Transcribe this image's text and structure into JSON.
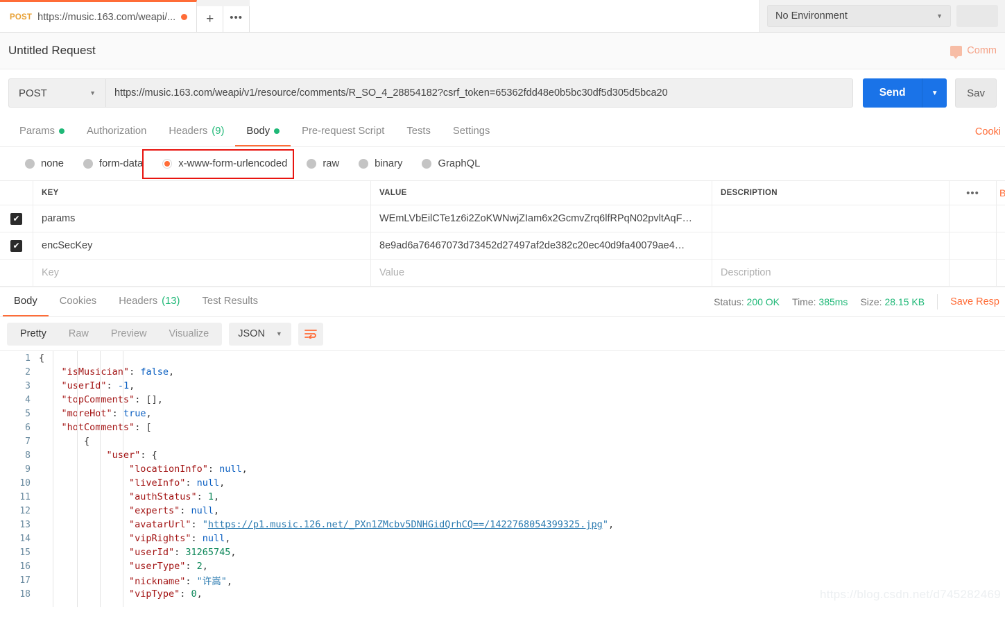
{
  "tab": {
    "method": "POST",
    "url_short": "https://music.163.com/weapi/...",
    "new_tab_icon": "plus-icon",
    "more_icon": "ellipsis-icon"
  },
  "environment": {
    "selected": "No Environment",
    "caret": "▼"
  },
  "header": {
    "title": "Untitled Request",
    "comments_label": "Comm"
  },
  "request": {
    "method": "POST",
    "url": "https://music.163.com/weapi/v1/resource/comments/R_SO_4_28854182?csrf_token=65362fdd48e0b5bc30df5d305d5bca20",
    "send_label": "Send",
    "send_caret": "▼",
    "save_label": "Sav",
    "method_caret": "▼"
  },
  "request_tabs": [
    {
      "label": "Params",
      "dot": true,
      "count": "",
      "active": false
    },
    {
      "label": "Authorization",
      "dot": false,
      "count": "",
      "active": false
    },
    {
      "label": "Headers",
      "dot": false,
      "count": "(9)",
      "active": false
    },
    {
      "label": "Body",
      "dot": true,
      "count": "",
      "active": true
    },
    {
      "label": "Pre-request Script",
      "dot": false,
      "count": "",
      "active": false
    },
    {
      "label": "Tests",
      "dot": false,
      "count": "",
      "active": false
    },
    {
      "label": "Settings",
      "dot": false,
      "count": "",
      "active": false
    }
  ],
  "cookies_link": "Cooki",
  "body_modes": [
    {
      "label": "none",
      "selected": false
    },
    {
      "label": "form-data",
      "selected": false
    },
    {
      "label": "x-www-form-urlencoded",
      "selected": true
    },
    {
      "label": "raw",
      "selected": false
    },
    {
      "label": "binary",
      "selected": false
    },
    {
      "label": "GraphQL",
      "selected": false
    }
  ],
  "highlight_color": "#e8140f",
  "kv_table": {
    "headers": {
      "key": "KEY",
      "value": "VALUE",
      "description": "DESCRIPTION",
      "actions": "•••",
      "bulk": "B"
    },
    "rows": [
      {
        "checked": true,
        "key": "params",
        "value": "WEmLVbEilCTe1z6i2ZoKWNwjZIam6x2GcmvZrq6lfRPqN02pvltAqF…",
        "description": ""
      },
      {
        "checked": true,
        "key": "encSecKey",
        "value": "8e9ad6a76467073d73452d27497af2de382c20ec40d9fa40079ae4…",
        "description": ""
      }
    ],
    "empty_row": {
      "key": "Key",
      "value": "Value",
      "description": "Description"
    }
  },
  "response_tabs": [
    {
      "label": "Body",
      "count": "",
      "active": true
    },
    {
      "label": "Cookies",
      "count": "",
      "active": false
    },
    {
      "label": "Headers",
      "count": "(13)",
      "active": false
    },
    {
      "label": "Test Results",
      "count": "",
      "active": false
    }
  ],
  "response_meta": {
    "status_label": "Status:",
    "status_value": "200 OK",
    "time_label": "Time:",
    "time_value": "385ms",
    "size_label": "Size:",
    "size_value": "28.15 KB",
    "save_response": "Save Resp"
  },
  "response_toolbar": {
    "view_modes": [
      {
        "label": "Pretty",
        "active": true
      },
      {
        "label": "Raw",
        "active": false
      },
      {
        "label": "Preview",
        "active": false
      },
      {
        "label": "Visualize",
        "active": false
      }
    ],
    "format": "JSON",
    "format_caret": "▼",
    "wrap_icon": "wrap-lines-icon"
  },
  "code": {
    "lines": [
      {
        "n": "1",
        "indent": 0,
        "tokens": [
          {
            "t": "p",
            "v": "{"
          }
        ]
      },
      {
        "n": "2",
        "indent": 1,
        "tokens": [
          {
            "t": "k",
            "v": "\"isMusician\""
          },
          {
            "t": "p",
            "v": ": "
          },
          {
            "t": "b",
            "v": "false"
          },
          {
            "t": "p",
            "v": ","
          }
        ]
      },
      {
        "n": "3",
        "indent": 1,
        "tokens": [
          {
            "t": "k",
            "v": "\"userId\""
          },
          {
            "t": "p",
            "v": ": "
          },
          {
            "t": "b",
            "v": "-1"
          },
          {
            "t": "p",
            "v": ","
          }
        ]
      },
      {
        "n": "4",
        "indent": 1,
        "tokens": [
          {
            "t": "k",
            "v": "\"topComments\""
          },
          {
            "t": "p",
            "v": ": [],"
          }
        ]
      },
      {
        "n": "5",
        "indent": 1,
        "tokens": [
          {
            "t": "k",
            "v": "\"moreHot\""
          },
          {
            "t": "p",
            "v": ": "
          },
          {
            "t": "b",
            "v": "true"
          },
          {
            "t": "p",
            "v": ","
          }
        ]
      },
      {
        "n": "6",
        "indent": 1,
        "tokens": [
          {
            "t": "k",
            "v": "\"hotComments\""
          },
          {
            "t": "p",
            "v": ": ["
          }
        ]
      },
      {
        "n": "7",
        "indent": 2,
        "tokens": [
          {
            "t": "p",
            "v": "{"
          }
        ]
      },
      {
        "n": "8",
        "indent": 3,
        "tokens": [
          {
            "t": "k",
            "v": "\"user\""
          },
          {
            "t": "p",
            "v": ": {"
          }
        ]
      },
      {
        "n": "9",
        "indent": 4,
        "tokens": [
          {
            "t": "k",
            "v": "\"locationInfo\""
          },
          {
            "t": "p",
            "v": ": "
          },
          {
            "t": "b",
            "v": "null"
          },
          {
            "t": "p",
            "v": ","
          }
        ]
      },
      {
        "n": "10",
        "indent": 4,
        "tokens": [
          {
            "t": "k",
            "v": "\"liveInfo\""
          },
          {
            "t": "p",
            "v": ": "
          },
          {
            "t": "b",
            "v": "null"
          },
          {
            "t": "p",
            "v": ","
          }
        ]
      },
      {
        "n": "11",
        "indent": 4,
        "tokens": [
          {
            "t": "k",
            "v": "\"authStatus\""
          },
          {
            "t": "p",
            "v": ": "
          },
          {
            "t": "n",
            "v": "1"
          },
          {
            "t": "p",
            "v": ","
          }
        ]
      },
      {
        "n": "12",
        "indent": 4,
        "tokens": [
          {
            "t": "k",
            "v": "\"experts\""
          },
          {
            "t": "p",
            "v": ": "
          },
          {
            "t": "b",
            "v": "null"
          },
          {
            "t": "p",
            "v": ","
          }
        ]
      },
      {
        "n": "13",
        "indent": 4,
        "tokens": [
          {
            "t": "k",
            "v": "\"avatarUrl\""
          },
          {
            "t": "p",
            "v": ": "
          },
          {
            "t": "s",
            "v": "\""
          },
          {
            "t": "lnk",
            "v": "https://p1.music.126.net/_PXn1ZMcbv5DNHGidQrhCQ==/1422768054399325.jpg"
          },
          {
            "t": "s",
            "v": "\""
          },
          {
            "t": "p",
            "v": ","
          }
        ]
      },
      {
        "n": "14",
        "indent": 4,
        "tokens": [
          {
            "t": "k",
            "v": "\"vipRights\""
          },
          {
            "t": "p",
            "v": ": "
          },
          {
            "t": "b",
            "v": "null"
          },
          {
            "t": "p",
            "v": ","
          }
        ]
      },
      {
        "n": "15",
        "indent": 4,
        "tokens": [
          {
            "t": "k",
            "v": "\"userId\""
          },
          {
            "t": "p",
            "v": ": "
          },
          {
            "t": "n",
            "v": "31265745"
          },
          {
            "t": "p",
            "v": ","
          }
        ]
      },
      {
        "n": "16",
        "indent": 4,
        "tokens": [
          {
            "t": "k",
            "v": "\"userType\""
          },
          {
            "t": "p",
            "v": ": "
          },
          {
            "t": "n",
            "v": "2"
          },
          {
            "t": "p",
            "v": ","
          }
        ]
      },
      {
        "n": "17",
        "indent": 4,
        "tokens": [
          {
            "t": "k",
            "v": "\"nickname\""
          },
          {
            "t": "p",
            "v": ": "
          },
          {
            "t": "s",
            "v": "\"许嵩\""
          },
          {
            "t": "p",
            "v": ","
          }
        ]
      },
      {
        "n": "18",
        "indent": 4,
        "tokens": [
          {
            "t": "k",
            "v": "\"vipType\""
          },
          {
            "t": "p",
            "v": ": "
          },
          {
            "t": "n",
            "v": "0"
          },
          {
            "t": "p",
            "v": ","
          }
        ]
      }
    ]
  },
  "watermark": "https://blog.csdn.net/d745282469",
  "colors": {
    "accent": "#ff6c37",
    "send_blue": "#1a73e8",
    "green": "#1fb877",
    "highlight_red": "#e8140f"
  }
}
